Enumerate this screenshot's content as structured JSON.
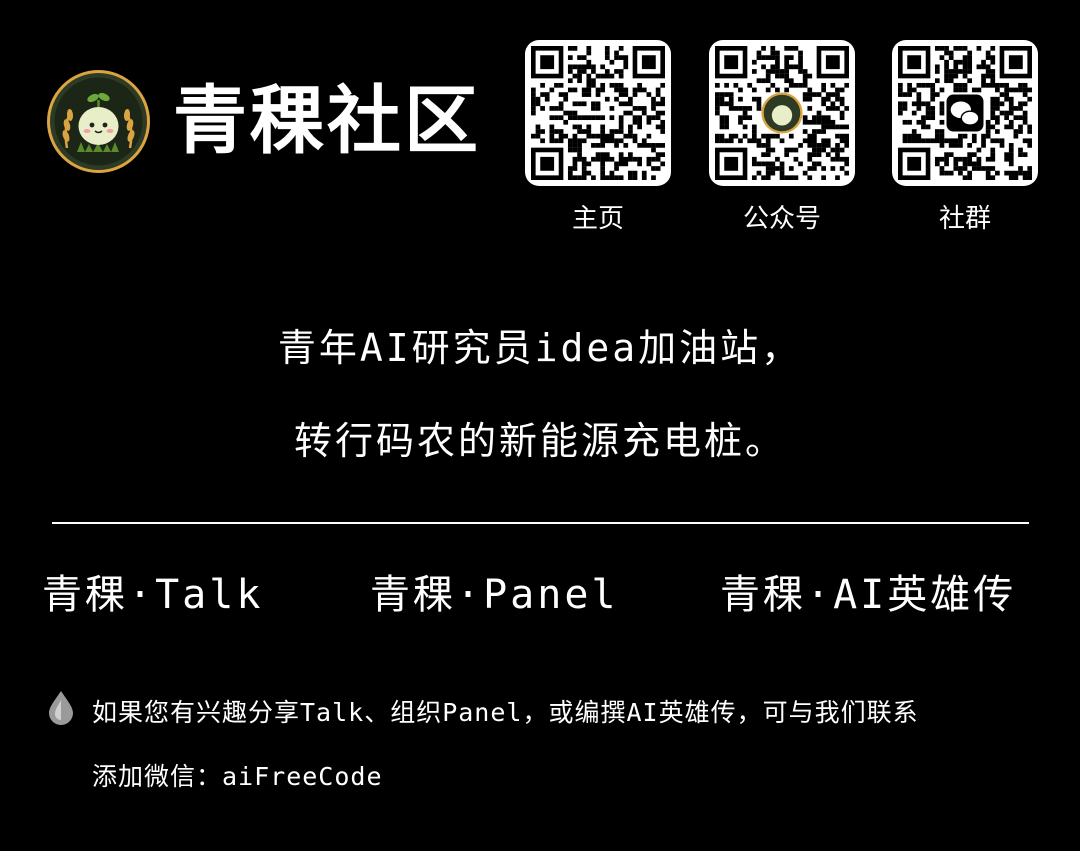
{
  "brand": {
    "name": "青稞社区",
    "logo_icon": "sprout-mascot-icon"
  },
  "qr_codes": [
    {
      "label": "主页",
      "icon": "qr-code-icon"
    },
    {
      "label": "公众号",
      "icon": "qr-code-with-mascot-icon"
    },
    {
      "label": "社群",
      "icon": "qr-code-with-wechat-icon"
    }
  ],
  "tagline": {
    "line1": "青年AI研究员idea加油站，",
    "line2": "转行码农的新能源充电桩。"
  },
  "series": [
    "青稞·Talk",
    "青稞·Panel",
    "青稞·AI英雄传"
  ],
  "note": {
    "icon": "drop-icon",
    "line1": "如果您有兴趣分享Talk、组织Panel，或编撰AI英雄传，可与我们联系",
    "line2": "添加微信：aiFreeCode"
  },
  "colors": {
    "background": "#000000",
    "text": "#ffffff",
    "logo_green": "#4a6b2c",
    "logo_gold": "#d9a441"
  }
}
